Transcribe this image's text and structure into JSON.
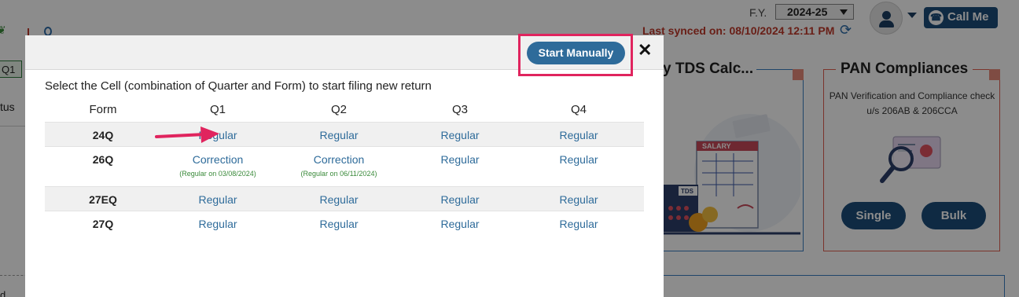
{
  "header": {
    "fy_label": "F.Y.",
    "fy_value": "2024-25",
    "last_synced": "Last synced on: 08/10/2024 12:11 PM",
    "call_me": "Call Me"
  },
  "left": {
    "tab": "Q1",
    "status_fragment": "tus",
    "bottom_fragment": "d"
  },
  "cards": {
    "tds_title": "y TDS Calc...",
    "tds_image_label_salary": "SALARY",
    "tds_image_label_tds": "TDS",
    "pan_title": "PAN Compliances",
    "pan_desc": "PAN Verification and Compliance check u/s 206AB & 206CCA",
    "pan_single": "Single",
    "pan_bulk": "Bulk"
  },
  "modal": {
    "start_manually": "Start Manually",
    "close": "✕",
    "instructions": "Select the Cell (combination of Quarter and Form) to start filing new return",
    "headers": [
      "Form",
      "Q1",
      "Q2",
      "Q3",
      "Q4"
    ],
    "rows": [
      {
        "form": "24Q",
        "q1": "Regular",
        "q2": "Regular",
        "q3": "Regular",
        "q4": "Regular",
        "q1_note": "",
        "q2_note": ""
      },
      {
        "form": "26Q",
        "q1": "Correction",
        "q2": "Correction",
        "q3": "Regular",
        "q4": "Regular",
        "q1_note": "(Regular on 03/08/2024)",
        "q2_note": "(Regular on 06/11/2024)"
      },
      {
        "form": "27EQ",
        "q1": "Regular",
        "q2": "Regular",
        "q3": "Regular",
        "q4": "Regular",
        "q1_note": "",
        "q2_note": ""
      },
      {
        "form": "27Q",
        "q1": "Regular",
        "q2": "Regular",
        "q3": "Regular",
        "q4": "Regular",
        "q1_note": "",
        "q2_note": ""
      }
    ]
  },
  "colors": {
    "primary": "#2e6b9a",
    "highlight": "#e0245e",
    "note": "#3a8a3a",
    "synced": "#c0392b"
  }
}
